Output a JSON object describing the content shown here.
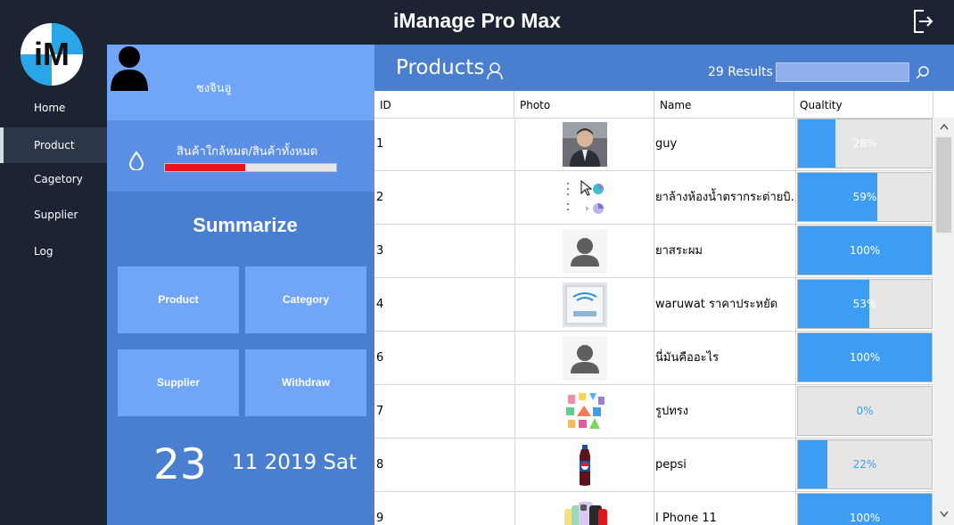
{
  "app": {
    "title": "iManage Pro Max"
  },
  "sidebar": {
    "logo_text": "iM",
    "items": [
      {
        "label": "Home"
      },
      {
        "label": "Product",
        "active": true
      },
      {
        "label": "Cagetory"
      },
      {
        "label": "Supplier"
      },
      {
        "label": "Log"
      }
    ]
  },
  "user": {
    "name": "ชงจินอู"
  },
  "stock": {
    "label": "สินค้าใกล้หมด/สินค้าทั้งหมด",
    "ratio": 0.47,
    "bar_color": "#e8141c"
  },
  "summary": {
    "title": "Summarize",
    "tiles": [
      {
        "label": "Product"
      },
      {
        "label": "Category"
      },
      {
        "label": "Supplier"
      },
      {
        "label": "Withdraw"
      }
    ]
  },
  "date": {
    "day": "23",
    "rest": "11 2019 Sat"
  },
  "products": {
    "title": "Products",
    "results": "29 Results",
    "search_value": "",
    "columns": [
      "ID",
      "Photo",
      "Name",
      "Qualtity"
    ],
    "rows": [
      {
        "id": "1",
        "photo": "portrait-photo",
        "name": "guy",
        "quality": "28%",
        "pct": 28
      },
      {
        "id": "2",
        "photo": "chart-thumbnail",
        "name": "ยาล้างห้องน้ำตรากระต่ายบิ.",
        "quality": "59%",
        "pct": 59
      },
      {
        "id": "3",
        "photo": "default-user-photo",
        "name": "ยาสระผม",
        "quality": "100%",
        "pct": 100
      },
      {
        "id": "4",
        "photo": "package-photo",
        "name": "waruwat ราคาประหยัด",
        "quality": "53%",
        "pct": 53
      },
      {
        "id": "6",
        "photo": "default-user-photo",
        "name": "นี่มันคืออะไร",
        "quality": "100%",
        "pct": 100
      },
      {
        "id": "7",
        "photo": "colorful-shapes-photo",
        "name": "รูปทรง",
        "quality": "0%",
        "pct": 0
      },
      {
        "id": "8",
        "photo": "pepsi-bottle-photo",
        "name": "pepsi",
        "quality": "22%",
        "pct": 22
      },
      {
        "id": "9",
        "photo": "iphone-photo",
        "name": "I Phone 11",
        "quality": "100%",
        "pct": 100
      }
    ]
  },
  "colors": {
    "sidebar": "#1c2434",
    "panel": "#4a7fd0",
    "tile": "#70a5f8",
    "quality_fill": "#3d9df3"
  }
}
